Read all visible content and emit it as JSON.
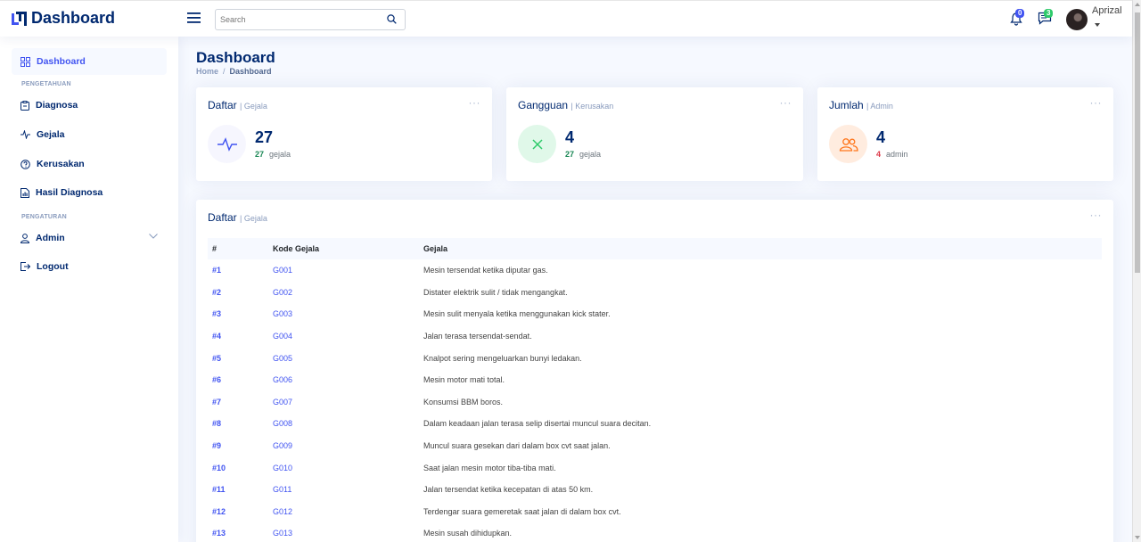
{
  "header": {
    "logo_text": "Dashboard",
    "search": {
      "placeholder": "Search",
      "value": ""
    },
    "notifications": {
      "count": "0"
    },
    "messages": {
      "count": "3"
    },
    "user": {
      "name": "Aprizal"
    }
  },
  "sidebar": {
    "items": [
      {
        "label": "Dashboard",
        "icon": "grid-icon",
        "active": true
      },
      {
        "label": "Diagnosa",
        "icon": "clipboard-icon"
      },
      {
        "label": "Gejala",
        "icon": "activity-icon"
      },
      {
        "label": "Kerusakan",
        "icon": "question-circle-icon"
      },
      {
        "label": "Hasil Diagnosa",
        "icon": "file-bar-chart-icon"
      },
      {
        "label": "Admin",
        "icon": "person-icon"
      },
      {
        "label": "Logout",
        "icon": "logout-icon"
      }
    ],
    "headings": [
      "PENGETAHUAN",
      "PENGATURAN"
    ]
  },
  "main": {
    "title": "Dashboard",
    "breadcrumb": {
      "home": "Home",
      "separator": "/",
      "current": "Dashboard"
    }
  },
  "cards": [
    {
      "title": "Daftar",
      "subtitle": "| Gejala",
      "value": "27",
      "sub_value": "27",
      "sub_text": "gejala",
      "icon": "activity-icon",
      "accent": "#4154f1",
      "sub_color": "#198754"
    },
    {
      "title": "Gangguan",
      "subtitle": "| Kerusakan",
      "value": "4",
      "sub_value": "27",
      "sub_text": "gejala",
      "icon": "x-icon",
      "accent": "#2eca6a",
      "sub_color": "#198754"
    },
    {
      "title": "Jumlah",
      "subtitle": "| Admin",
      "value": "4",
      "sub_value": "4",
      "sub_text": "admin",
      "icon": "people-icon",
      "accent": "#ff771d",
      "sub_color": "#dc3545"
    }
  ],
  "table_card": {
    "title": "Daftar",
    "subtitle": "| Gejala",
    "columns": [
      "#",
      "Kode Gejala",
      "Gejala"
    ],
    "rows": [
      {
        "num": "#1",
        "code": "G001",
        "desc": "Mesin tersendat ketika diputar gas."
      },
      {
        "num": "#2",
        "code": "G002",
        "desc": "Distater elektrik sulit / tidak mengangkat."
      },
      {
        "num": "#3",
        "code": "G003",
        "desc": "Mesin sulit menyala ketika menggunakan kick stater."
      },
      {
        "num": "#4",
        "code": "G004",
        "desc": "Jalan terasa tersendat-sendat."
      },
      {
        "num": "#5",
        "code": "G005",
        "desc": "Knalpot sering mengeluarkan bunyi ledakan."
      },
      {
        "num": "#6",
        "code": "G006",
        "desc": "Mesin motor mati total."
      },
      {
        "num": "#7",
        "code": "G007",
        "desc": "Konsumsi BBM boros."
      },
      {
        "num": "#8",
        "code": "G008",
        "desc": "Dalam keadaan jalan terasa selip disertai muncul suara decitan."
      },
      {
        "num": "#9",
        "code": "G009",
        "desc": "Muncul suara gesekan dari dalam box cvt saat jalan."
      },
      {
        "num": "#10",
        "code": "G010",
        "desc": "Saat jalan mesin motor tiba-tiba mati."
      },
      {
        "num": "#11",
        "code": "G011",
        "desc": "Jalan tersendat ketika kecepatan di atas 50 km."
      },
      {
        "num": "#12",
        "code": "G012",
        "desc": "Terdengar suara gemeretak saat jalan di dalam box cvt."
      },
      {
        "num": "#13",
        "code": "G013",
        "desc": "Mesin susah dihidupkan."
      }
    ]
  }
}
